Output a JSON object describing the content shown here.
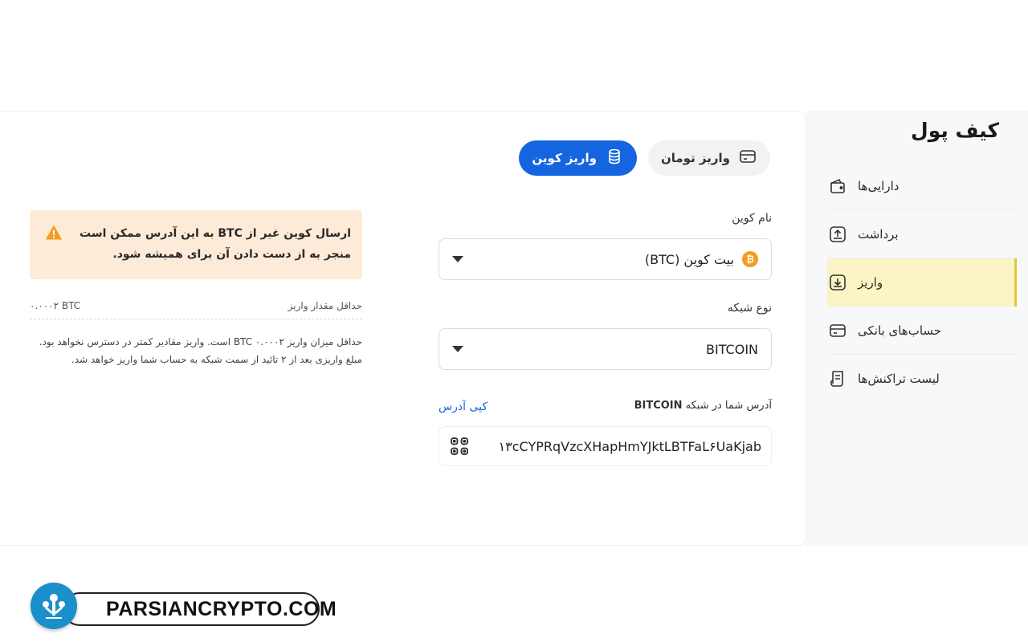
{
  "sidebar": {
    "title": "کیف پول",
    "items": [
      {
        "label": "دارایی‌ها",
        "icon": "wallet-icon",
        "active": false
      },
      {
        "label": "برداشت",
        "icon": "upload-icon",
        "active": false
      },
      {
        "label": "واریز",
        "icon": "download-icon",
        "active": true
      },
      {
        "label": "حساب‌های بانکی",
        "icon": "card-icon",
        "active": false
      },
      {
        "label": "لیست تراکنش‌ها",
        "icon": "receipt-icon",
        "active": false
      }
    ]
  },
  "tabs": {
    "coin_deposit": "واریز کوین",
    "toman_deposit": "واریز تومان"
  },
  "form": {
    "coin_label": "نام کوین",
    "coin_value": "بیت کوین (BTC)",
    "coin_badge": "₿",
    "network_label": "نوع شبکه",
    "network_value": "BITCOIN",
    "address_label_prefix": "آدرس شما در شبکه",
    "address_label_network": "BITCOIN",
    "copy_label": "کپی آدرس",
    "address": "۱۳cCYPRqVzcXHapHmYJktLBTFaL۶UaKjab"
  },
  "warning": {
    "part1": "ارسال کوین غیر از ",
    "coin": "BTC",
    "part2": " به این آدرس ممکن است منجر به از دست دادن آن برای همیشه شود."
  },
  "min_deposit": {
    "label": "حداقل مقدار واریز",
    "value": "۰.۰۰۰۲ BTC"
  },
  "notes": [
    "حداقل میزان واریز BTC ۰.۰۰۰۲ است. واریز مقادیر کمتر در دسترس نخواهد بود.",
    "مبلغ واریزی بعد از ۲ تائید از سمت شبکه به حساب شما واریز خواهد شد."
  ],
  "watermark": {
    "text": "PARSIANCRYPTO.COM"
  },
  "colors": {
    "accent": "#1565e0",
    "active_bg": "#fbf4c4",
    "active_border": "#e7c43a",
    "warning_bg": "#fdebd7",
    "warning_icon": "#f39c20"
  }
}
